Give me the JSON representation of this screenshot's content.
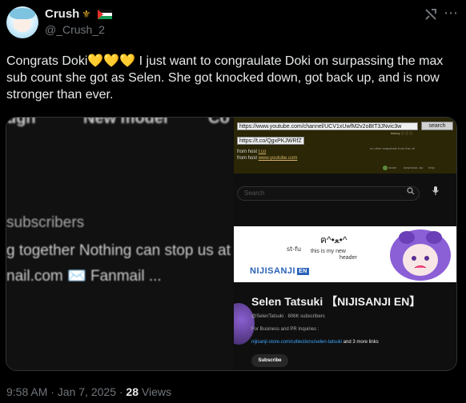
{
  "user": {
    "name": "Crush",
    "crown_emoji": "⚜",
    "handle": "@_Crush_2"
  },
  "header": {
    "grok_icon": "grok-icon",
    "more_label": "⋯"
  },
  "tweet": {
    "text": "Congrats Doki💛💛💛 I just want to congraulate Doki on surpassing the max sub count she got as Selen. She got knocked down, got back up, and is now stronger than ever."
  },
  "media_left": {
    "tab1": "ugh",
    "tab2": "New model",
    "tab3": "Co",
    "subscribers": "subscribers",
    "line1": "g together Nothing can stop us at a",
    "line2": "nail.com ✉️ Fanmail ..."
  },
  "media_right": {
    "wayback": {
      "url": "https://www.youtube.com/channel/UCV1xUwfM2v2oBtT3JNvic3w",
      "search_label": "search",
      "short_url": "https://t.co/QgxPKJWRfZ",
      "links": "history    ⓘ  ⓘ  ⓘ",
      "from1_prefix": "from host ",
      "from1_link": "t.co",
      "from2_prefix": "from host ",
      "from2_link": "www.youtube.com",
      "note": "no other snapshots from this url",
      "foot1": "share",
      "foot2": "download .zip",
      "foot3": "help"
    },
    "yt": {
      "search_placeholder": "Search",
      "banner_stfu": "st-fu",
      "banner_note": "this is my new",
      "banner_note2": "header",
      "banner_logo": "NIJISANJI",
      "banner_logo_en": "EN",
      "channel_name": "Selen Tatsuki 【NIJISANJI EN】",
      "channel_meta": "@SelenTatsuki · 806K subscribers",
      "biz": "For Business and PR Inquiries :",
      "link_url": "nijisanji-store.com/collections/selen-tatsuki",
      "link_more": " and 3 more links",
      "subscribe_label": "Subscribe"
    }
  },
  "meta": {
    "time": "9:58 AM · Jan 7, 2025 · ",
    "views_count": "28",
    "views_label": " Views"
  }
}
